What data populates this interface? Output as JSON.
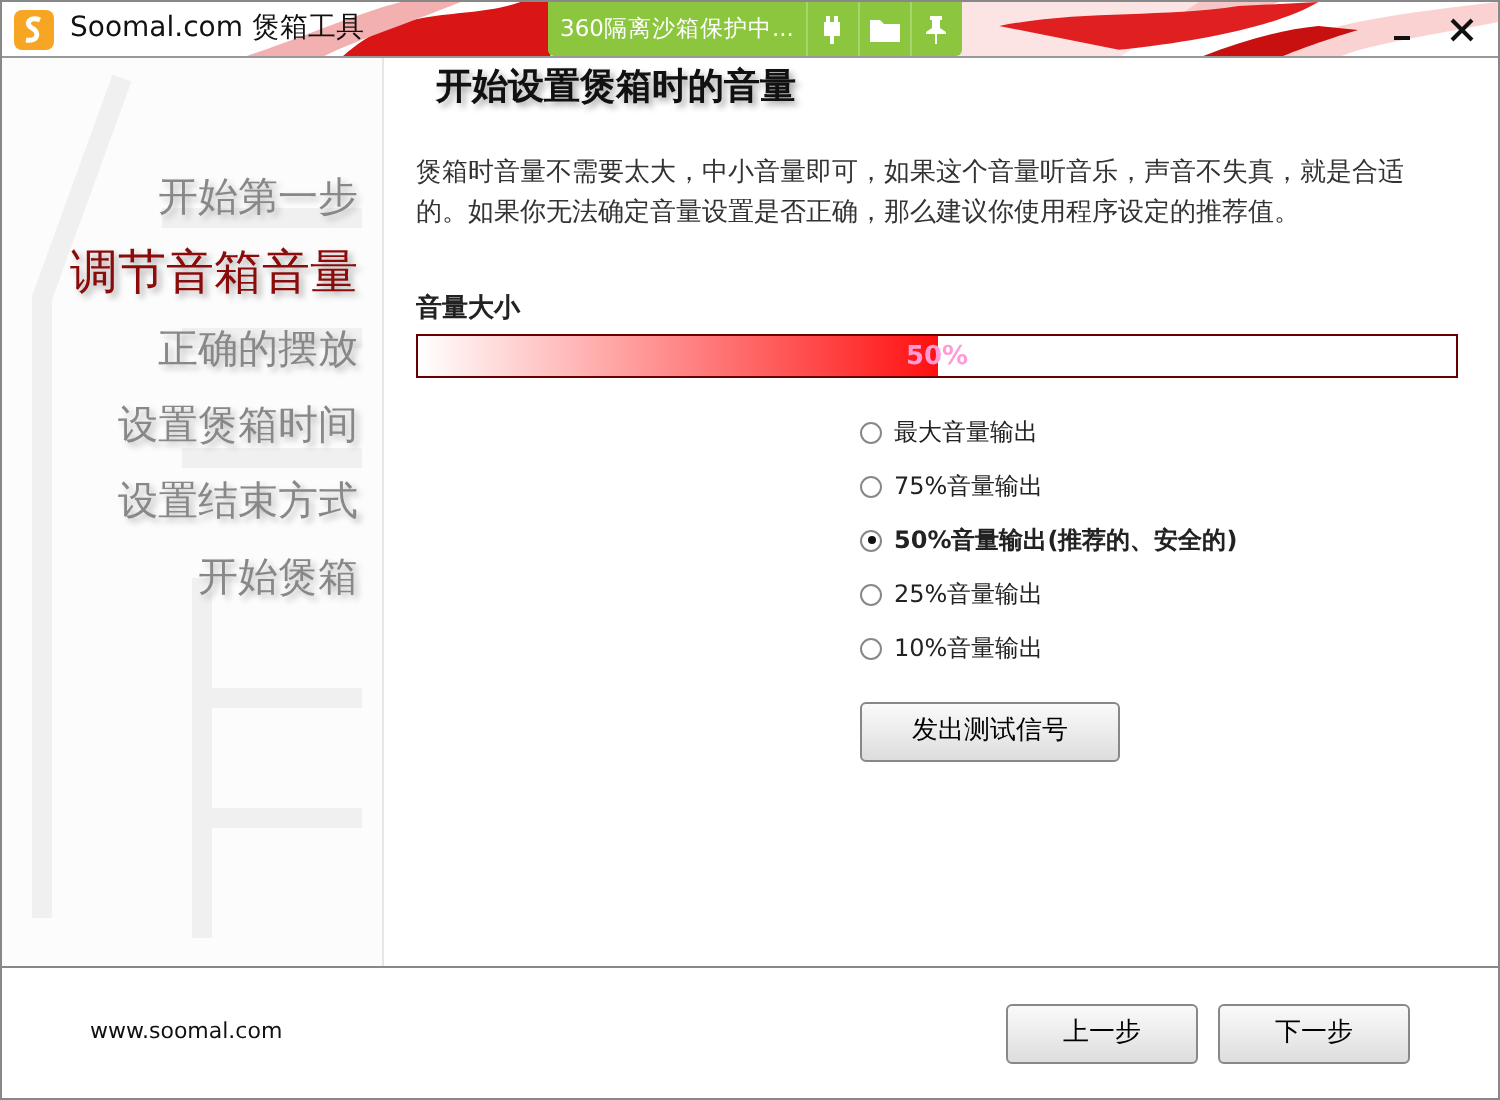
{
  "window": {
    "title": "Soomal.com 煲箱工具",
    "sandbox_badge": "360隔离沙箱保护中..."
  },
  "steps": [
    {
      "label": "开始第一步",
      "selected": false
    },
    {
      "label": "调节音箱音量",
      "selected": true
    },
    {
      "label": "正确的摆放",
      "selected": false
    },
    {
      "label": "设置煲箱时间",
      "selected": false
    },
    {
      "label": "设置结束方式",
      "selected": false
    },
    {
      "label": "开始煲箱",
      "selected": false
    }
  ],
  "heading": "开始设置煲箱时的音量",
  "description": "煲箱时音量不需要太大，中小音量即可，如果这个音量听音乐，声音不失真，就是合适的。如果你无法确定音量设置是否正确，那么建议你使用程序设定的推荐值。",
  "volume": {
    "label": "音量大小",
    "level": 0.5,
    "reading": "50%"
  },
  "options": [
    {
      "label": "最大音量输出",
      "selected": false
    },
    {
      "label": "75%音量输出",
      "selected": false
    },
    {
      "label": "50%音量输出(推荐的、安全的)",
      "selected": true
    },
    {
      "label": "25%音量输出",
      "selected": false
    },
    {
      "label": "10%音量输出",
      "selected": false
    }
  ],
  "test_button": "发出测试信号",
  "footer": {
    "link": "www.soomal.com",
    "buttons": [
      "上一步",
      "下一步"
    ]
  }
}
